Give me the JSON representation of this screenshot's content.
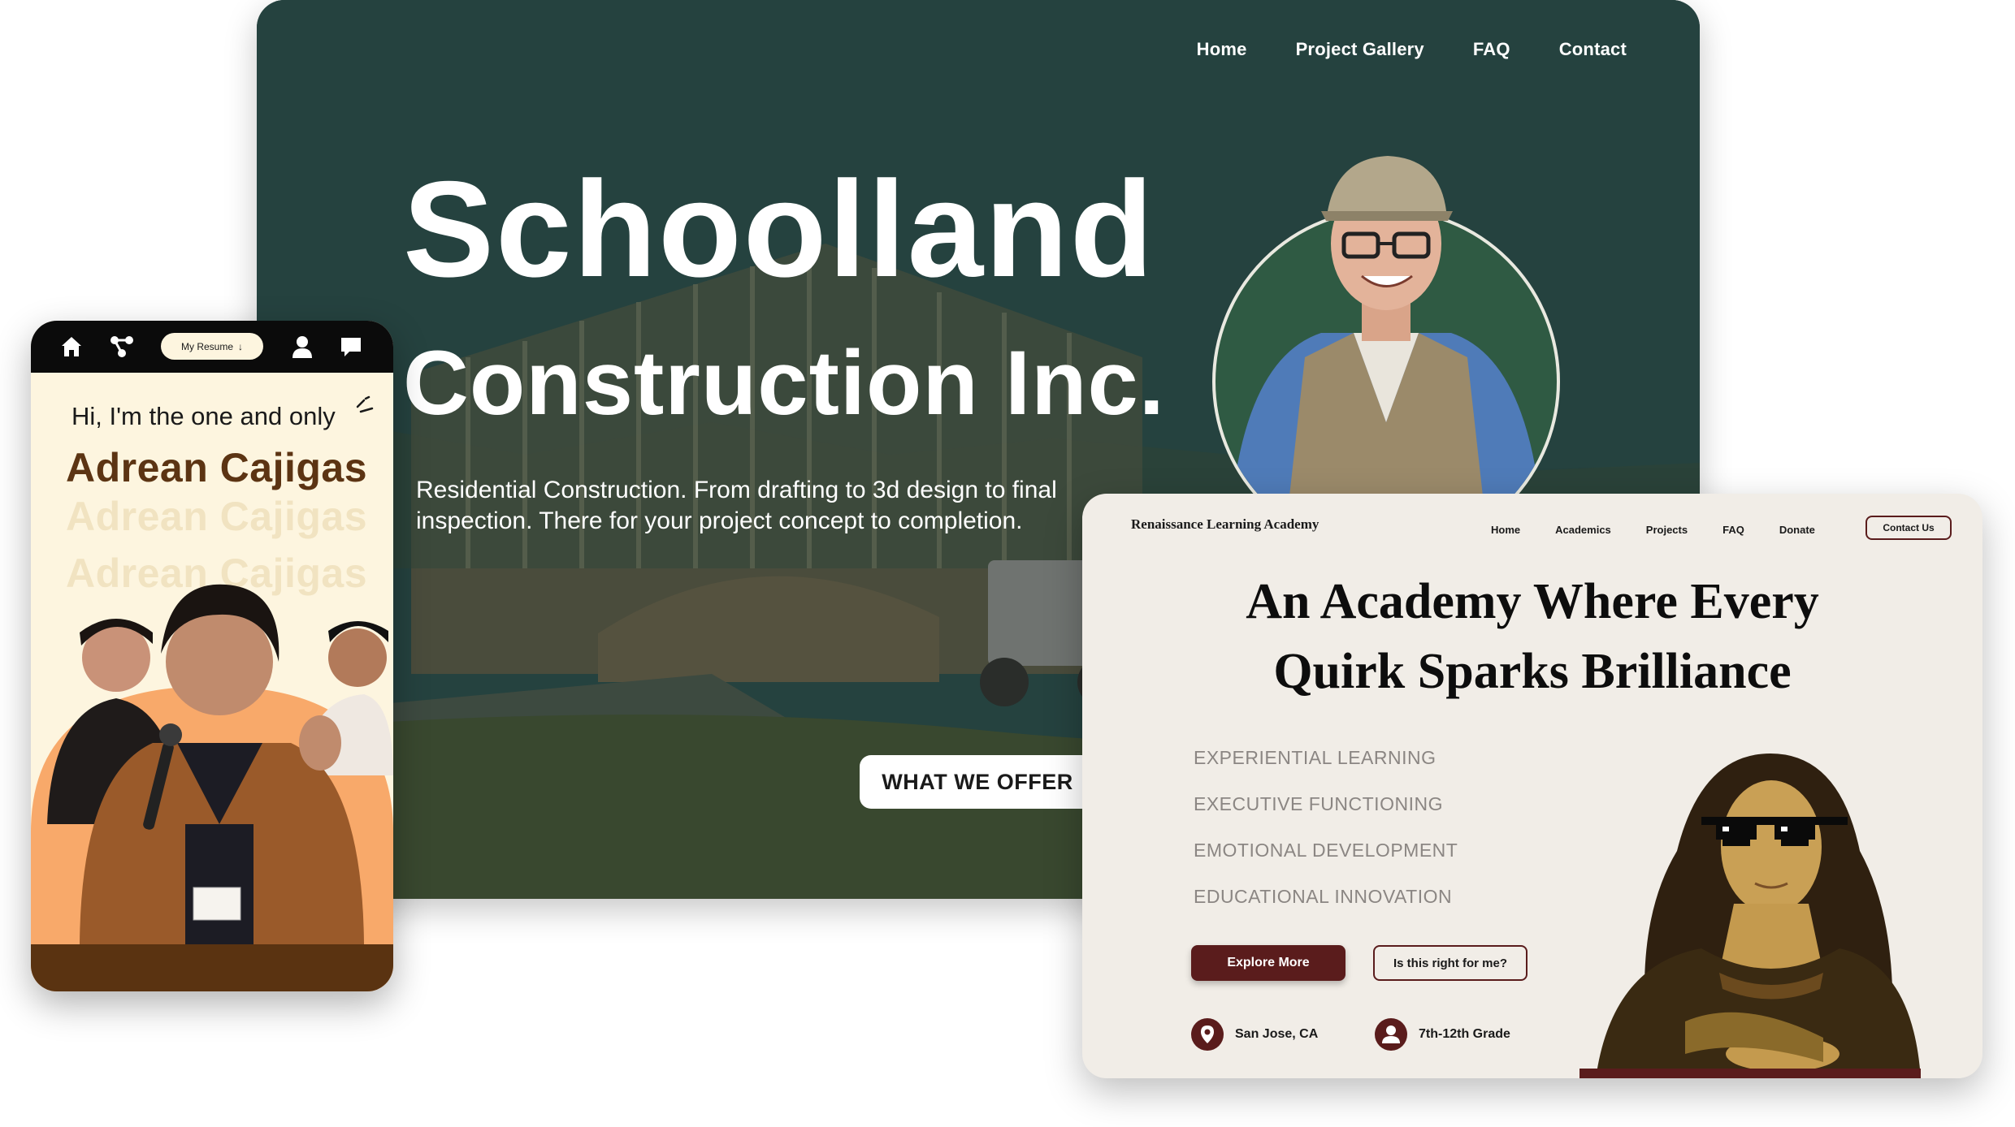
{
  "schoolland": {
    "nav": [
      "Home",
      "Project Gallery",
      "FAQ",
      "Contact"
    ],
    "title_line1": "Schoolland",
    "title_line2": "Construction Inc.",
    "description": "Residential Construction. From drafting to 3d design to final inspection. There for your project concept to completion.",
    "cta": "WHAT WE OFFER",
    "colors": {
      "overlay": "#24423f",
      "text": "#ffffff"
    }
  },
  "resume": {
    "nav_icons": [
      "home-icon",
      "share-nodes-icon",
      "user-icon",
      "chat-icon"
    ],
    "resume_button": "My Resume",
    "greeting": "Hi, I'm the one and only",
    "name": "Adrean Cajigas",
    "colors": {
      "background": "#fdf5df",
      "name": "#5c3413",
      "footer": "#5a3311",
      "accent": "#f8a96a"
    }
  },
  "academy": {
    "logo": "Renaissance Learning Academy",
    "nav": [
      "Home",
      "Academics",
      "Projects",
      "FAQ",
      "Donate"
    ],
    "contact_button": "Contact Us",
    "headline_line1": "An Academy Where Every",
    "headline_line2": "Quirk Sparks Brilliance",
    "pillars": [
      "EXPERIENTIAL LEARNING",
      "EXECUTIVE FUNCTIONING",
      "EMOTIONAL DEVELOPMENT",
      "EDUCATIONAL INNOVATION"
    ],
    "primary_button": "Explore More",
    "secondary_button": "Is this right for me?",
    "location": "San Jose, CA",
    "grades": "7th-12th Grade",
    "colors": {
      "accent": "#5a1c1c",
      "background": "#f1ede7"
    }
  }
}
